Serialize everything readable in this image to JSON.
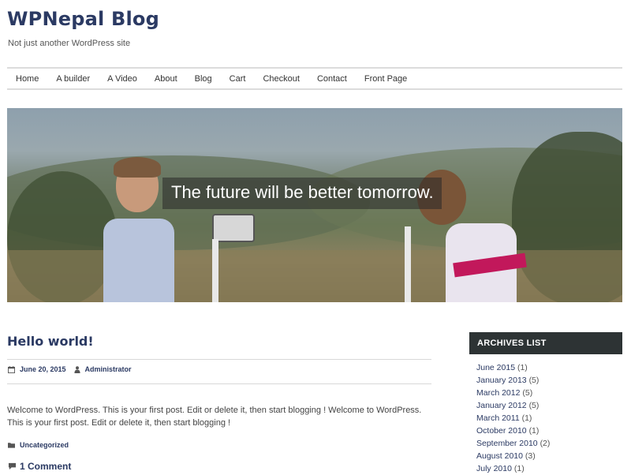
{
  "header": {
    "site_title": "WPNepal Blog",
    "tagline": "Not just another WordPress site"
  },
  "nav": {
    "items": [
      "Home",
      "A builder",
      "A Video",
      "About",
      "Blog",
      "Cart",
      "Checkout",
      "Contact",
      "Front Page"
    ]
  },
  "hero": {
    "caption": "The future will be better tomorrow."
  },
  "post": {
    "title": "Hello world!",
    "date": "June 20, 2015",
    "author": "Administrator",
    "excerpt": "Welcome to WordPress. This is your first post. Edit or delete it, then start blogging ! Welcome to WordPress. This is your first post. Edit or delete it, then start blogging !",
    "category": "Uncategorized",
    "comments": "1 Comment"
  },
  "sidebar": {
    "archives_title": "ARCHIVES LIST",
    "archives": [
      {
        "label": "June 2015",
        "count": "(1)"
      },
      {
        "label": "January 2013",
        "count": "(5)"
      },
      {
        "label": "March 2012",
        "count": "(5)"
      },
      {
        "label": "January 2012",
        "count": "(5)"
      },
      {
        "label": "March 2011",
        "count": "(1)"
      },
      {
        "label": "October 2010",
        "count": "(1)"
      },
      {
        "label": "September 2010",
        "count": "(2)"
      },
      {
        "label": "August 2010",
        "count": "(3)"
      },
      {
        "label": "July 2010",
        "count": "(1)"
      }
    ]
  },
  "colors": {
    "accent": "#2b3a63",
    "widget_header": "#2d3334"
  }
}
